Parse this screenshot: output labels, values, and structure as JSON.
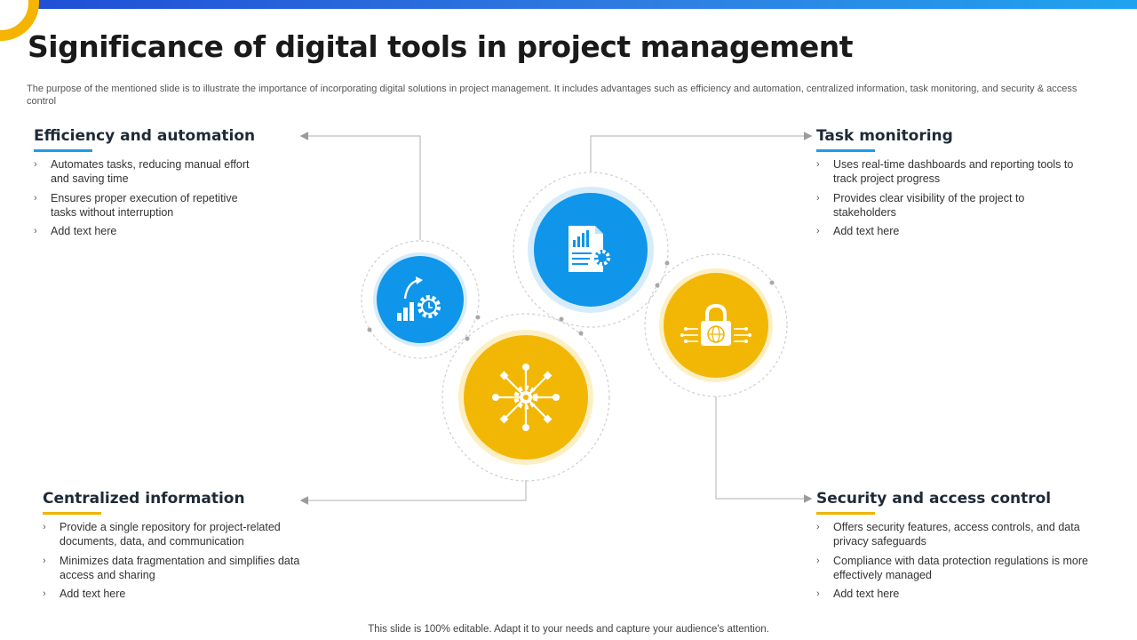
{
  "title": "Significance of digital tools in project management",
  "subtitle": "The purpose of the mentioned slide is to illustrate the importance of incorporating digital solutions in project management. It includes advantages such as efficiency and automation, centralized information, task monitoring, and security & access control",
  "sections": [
    {
      "heading": "Efficiency and automation",
      "bullets": [
        "Automates tasks, reducing manual effort and saving time",
        "Ensures proper execution of repetitive tasks without interruption",
        "Add text here"
      ]
    },
    {
      "heading": "Task monitoring",
      "bullets": [
        "Uses real-time dashboards and reporting tools to track project progress",
        "Provides clear visibility of the project to stakeholders",
        "Add text here"
      ]
    },
    {
      "heading": "Centralized information",
      "bullets": [
        "Provide a single repository for project-related documents, data, and communication",
        "Minimizes data fragmentation and simplifies data access and sharing",
        "Add text here"
      ]
    },
    {
      "heading": "Security and access control",
      "bullets": [
        "Offers security features, access controls, and data privacy safeguards",
        "Compliance with data protection regulations is more effectively managed",
        "Add text here"
      ]
    }
  ],
  "bullet_glyph": "›",
  "footer": "This slide is 100% editable. Adapt it to your needs and capture your audience's attention.",
  "colors": {
    "blue": "#0f95ea",
    "yellow": "#f2b705",
    "line": "#bfbfbf"
  },
  "icons": [
    "automation-gear-icon",
    "report-document-icon",
    "network-hub-icon",
    "security-lock-icon"
  ]
}
